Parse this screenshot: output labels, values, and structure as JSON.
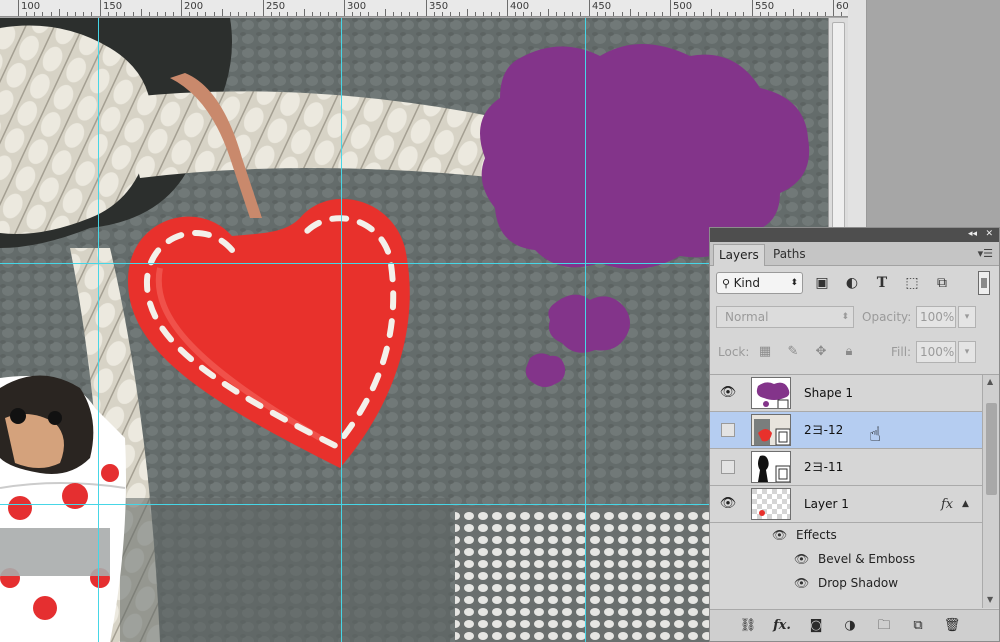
{
  "ruler": {
    "labels": [
      "100",
      "150",
      "200",
      "250",
      "300",
      "350",
      "400",
      "450",
      "500",
      "550",
      "60"
    ]
  },
  "layers_panel": {
    "tabs": [
      {
        "label": "Layers",
        "active": true
      },
      {
        "label": "Paths",
        "active": false
      }
    ],
    "filter_kind": "Kind",
    "blend_mode": "Normal",
    "opacity_label": "Opacity:",
    "opacity_value": "100%",
    "lock_label": "Lock:",
    "fill_label": "Fill:",
    "fill_value": "100%",
    "layers": [
      {
        "name": "Shape 1",
        "visible": true,
        "selected": false
      },
      {
        "name": "2ヨ-12",
        "visible": false,
        "selected": true
      },
      {
        "name": "2ヨ-11",
        "visible": false,
        "selected": false
      },
      {
        "name": "Layer 1",
        "visible": true,
        "selected": false,
        "has_fx": true
      }
    ],
    "effects_label": "Effects",
    "effects": [
      "Bevel & Emboss",
      "Drop Shadow"
    ]
  },
  "colors": {
    "shape_purple": "#83348a",
    "guide": "#46d6e6",
    "heart": "#e8312c",
    "selection": "#b5cdf1"
  }
}
